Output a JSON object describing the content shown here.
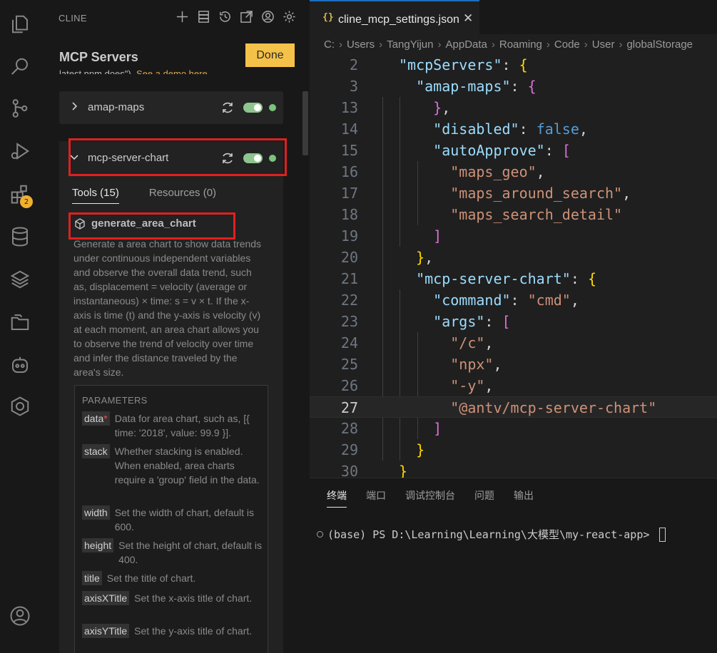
{
  "activity_bar": {
    "icons": [
      "files-icon",
      "search-icon",
      "source-control-icon",
      "run-debug-icon",
      "extensions-icon",
      "database-icon",
      "layers-icon",
      "folders-icon",
      "cline-robot-icon",
      "hexagon-icon",
      "account-icon"
    ],
    "extensions_badge": "2"
  },
  "cline_panel": {
    "header": "CLINE",
    "title": "MCP Servers",
    "done_label": "Done",
    "clipped_text": "latest npm does\"). See a demo here.",
    "clipped_link": "See a demo here.",
    "servers": [
      {
        "name": "amap-maps",
        "expanded": false,
        "enabled": true
      },
      {
        "name": "mcp-server-chart",
        "expanded": true,
        "enabled": true
      }
    ],
    "tabs": {
      "tools": "Tools (15)",
      "resources": "Resources (0)"
    },
    "tool": {
      "name": "generate_area_chart",
      "description": "Generate a area chart to show data trends under continuous independent variables and observe the overall data trend, such as, displacement = velocity (average or instantaneous) × time: s = v × t. If the x-axis is time (t) and the y-axis is velocity (v) at each moment, an area chart allows you to observe the trend of velocity over time and infer the distance traveled by the area's size."
    },
    "parameters_heading": "PARAMETERS",
    "parameters": [
      {
        "name": "data",
        "required_mark": "*",
        "desc": "Data for area chart, such as, [{ time: '2018', value: 99.9 }]."
      },
      {
        "name": "stack",
        "desc": "Whether stacking is enabled. When enabled, area charts require a 'group' field in the data."
      },
      {
        "name": "width",
        "desc": "Set the width of chart, default is 600."
      },
      {
        "name": "height",
        "desc": "Set the height of chart, default is 400."
      },
      {
        "name": "title",
        "desc": "Set the title of chart."
      },
      {
        "name": "axisXTitle",
        "desc": "Set the x-axis title of chart."
      },
      {
        "name": "axisYTitle",
        "desc": "Set the y-axis title of chart."
      }
    ]
  },
  "editor": {
    "tab": {
      "icon_text": "{}",
      "filename": "cline_mcp_settings.json",
      "close": "✕"
    },
    "breadcrumb": [
      "C:",
      "Users",
      "TangYijun",
      "AppData",
      "Roaming",
      "Code",
      "User",
      "globalStorage"
    ],
    "lines": [
      {
        "n": "2",
        "text": "  \"mcpServers\": {"
      },
      {
        "n": "3",
        "text": "    \"amap-maps\": {"
      },
      {
        "n": "13",
        "text": "      },"
      },
      {
        "n": "14",
        "text": "      \"disabled\": false,"
      },
      {
        "n": "15",
        "text": "      \"autoApprove\": ["
      },
      {
        "n": "16",
        "text": "        \"maps_geo\","
      },
      {
        "n": "17",
        "text": "        \"maps_around_search\","
      },
      {
        "n": "18",
        "text": "        \"maps_search_detail\""
      },
      {
        "n": "19",
        "text": "      ]"
      },
      {
        "n": "20",
        "text": "    },"
      },
      {
        "n": "21",
        "text": "    \"mcp-server-chart\": {"
      },
      {
        "n": "22",
        "text": "      \"command\": \"cmd\","
      },
      {
        "n": "23",
        "text": "      \"args\": ["
      },
      {
        "n": "24",
        "text": "        \"/c\","
      },
      {
        "n": "25",
        "text": "        \"npx\","
      },
      {
        "n": "26",
        "text": "        \"-y\","
      },
      {
        "n": "27",
        "text": "        \"@antv/mcp-server-chart\""
      },
      {
        "n": "28",
        "text": "      ]"
      },
      {
        "n": "29",
        "text": "    }"
      },
      {
        "n": "30",
        "text": "  }"
      }
    ],
    "current_line": "27"
  },
  "terminal": {
    "tabs": [
      "终端",
      "端口",
      "调试控制台",
      "问题",
      "输出"
    ],
    "active_tab": "终端",
    "prompt": "(base) PS D:\\Learning\\Learning\\大模型\\my-react-app>"
  },
  "colors": {
    "accent_done": "#f5c249",
    "highlight_box": "#e02020",
    "status_green": "#7cc47c"
  }
}
